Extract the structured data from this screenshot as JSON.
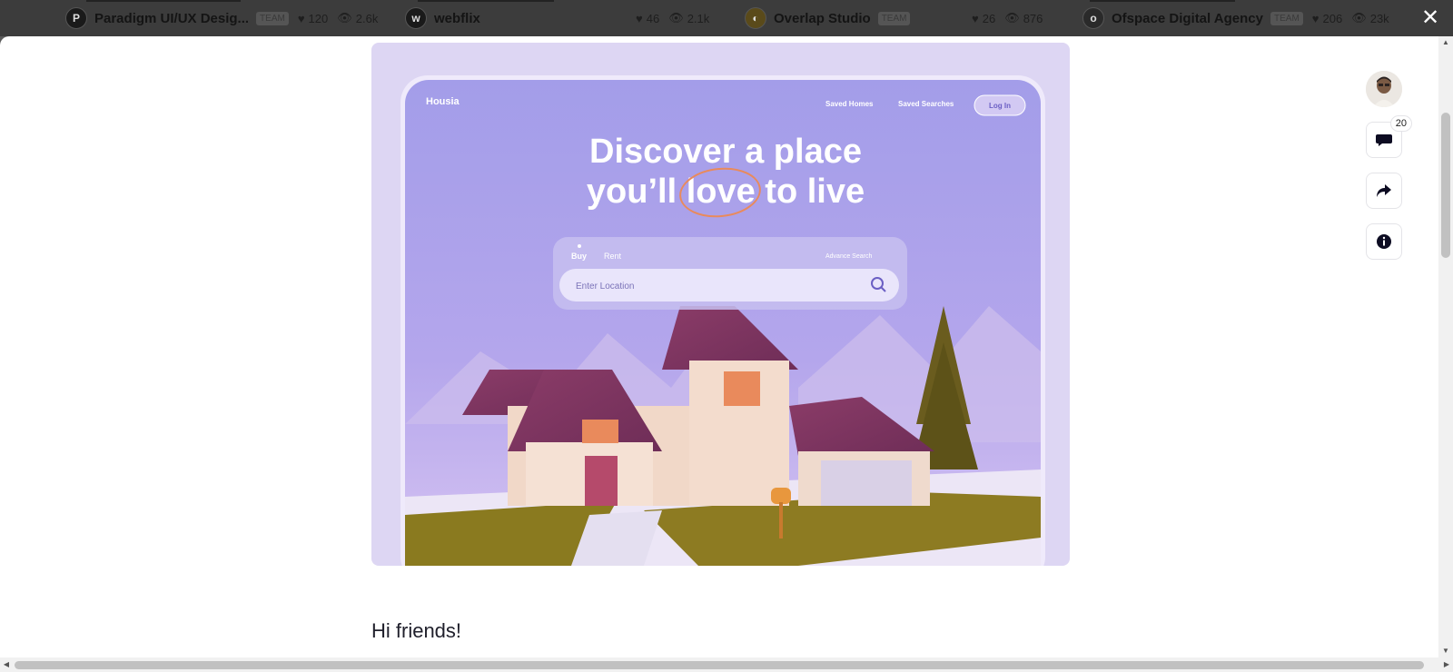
{
  "background_cards": [
    {
      "name": "Paradigm UI/UX Desig...",
      "team": "TEAM",
      "likes": "120",
      "views": "2.6k"
    },
    {
      "name": "webflix",
      "team": "",
      "likes": "46",
      "views": "2.1k"
    },
    {
      "name": "Overlap Studio",
      "team": "TEAM",
      "likes": "26",
      "views": "876"
    },
    {
      "name": "Ofspace Digital Agency",
      "team": "TEAM",
      "likes": "206",
      "views": "23k"
    }
  ],
  "shot": {
    "brand": "Housia",
    "nav": [
      "Saved Homes",
      "Saved Searches"
    ],
    "login": "Log In",
    "headline_line1": "Discover a place",
    "headline_line2_a": "you’ll ",
    "headline_line2_b": "love",
    "headline_line2_c": " to live",
    "tab_buy": "Buy",
    "tab_rent": "Rent",
    "advance": "Advance Search",
    "search_placeholder": "Enter Location"
  },
  "description": {
    "greeting": "Hi friends!"
  },
  "actions": {
    "comments_count": "20"
  },
  "colors": {
    "shot_bg": "#ddd6f3",
    "hero_purple": "#a59ce8",
    "accent_orange": "#e98a5c"
  }
}
